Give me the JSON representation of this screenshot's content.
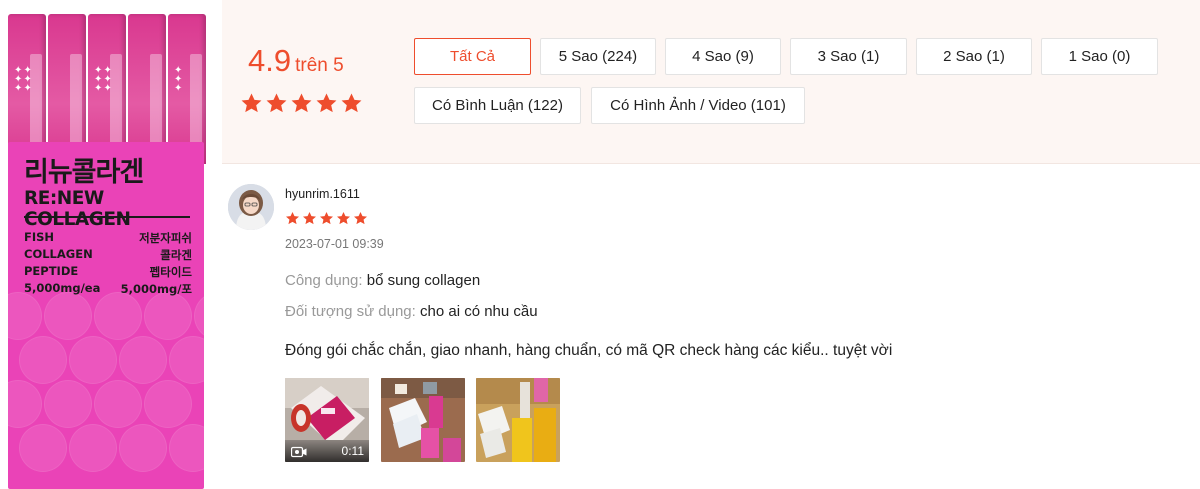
{
  "product_image": {
    "brand_kr": "리뉴콜라겐",
    "brand_en": "RE:NEW COLLAGEN",
    "stick_label": "RE:N",
    "specs_left": [
      "FISH",
      "COLLAGEN",
      "PEPTIDE",
      "5,000mg/ea"
    ],
    "specs_right": [
      "저분자피쉬",
      "콜라겐",
      "펩타이드",
      "5,000mg/포"
    ]
  },
  "rating_summary": {
    "score": "4.9",
    "out_of": "trên 5",
    "stars": 5,
    "accent_color": "#ee4d2d"
  },
  "filters": [
    {
      "label": "Tất Cả",
      "active": true
    },
    {
      "label": "5 Sao (224)",
      "active": false
    },
    {
      "label": "4 Sao (9)",
      "active": false
    },
    {
      "label": "3 Sao (1)",
      "active": false
    },
    {
      "label": "2 Sao (1)",
      "active": false
    },
    {
      "label": "1 Sao (0)",
      "active": false
    },
    {
      "label": "Có Bình Luận (122)",
      "active": false
    },
    {
      "label": "Có Hình Ảnh / Video (101)",
      "active": false
    }
  ],
  "review": {
    "username": "hyunrim.1611",
    "stars": 5,
    "datetime": "2023-07-01 09:39",
    "attributes": [
      {
        "label": "Công dụng:",
        "value": "bổ sung collagen"
      },
      {
        "label": "Đối tượng sử dụng:",
        "value": "cho ai có nhu cầu"
      }
    ],
    "comment": "Đóng gói chắc chắn, giao nhanh, hàng chuẩn, có mã QR check hàng các kiểu.. tuyệt vời",
    "media": [
      {
        "type": "video",
        "duration": "0:11",
        "icon": "video-camera-icon"
      },
      {
        "type": "image"
      },
      {
        "type": "image"
      }
    ]
  }
}
